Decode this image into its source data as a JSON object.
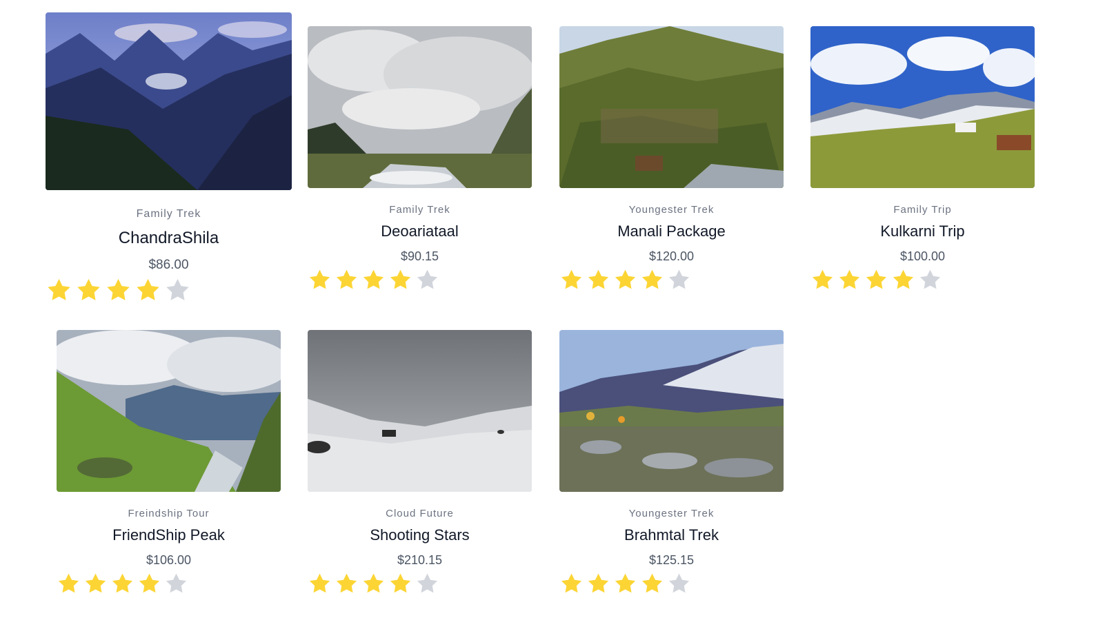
{
  "cards": [
    {
      "category": "Family Trek",
      "title": "ChandraShila",
      "price": "$86.00",
      "rating": 4,
      "max_rating": 5
    },
    {
      "category": "Family Trek",
      "title": "Deoariataal",
      "price": "$90.15",
      "rating": 4,
      "max_rating": 5
    },
    {
      "category": "Youngester Trek",
      "title": "Manali Package",
      "price": "$120.00",
      "rating": 4,
      "max_rating": 5
    },
    {
      "category": "Family Trip",
      "title": "Kulkarni Trip",
      "price": "$100.00",
      "rating": 4,
      "max_rating": 5
    },
    {
      "category": "Freindship Tour",
      "title": "FriendShip Peak",
      "price": "$106.00",
      "rating": 4,
      "max_rating": 5
    },
    {
      "category": "Cloud Future",
      "title": "Shooting Stars",
      "price": "$210.15",
      "rating": 4,
      "max_rating": 5
    },
    {
      "category": "Youngester Trek",
      "title": "Brahmtal Trek",
      "price": "$125.15",
      "rating": 4,
      "max_rating": 5
    }
  ],
  "colors": {
    "star_filled": "#fcd535",
    "star_empty": "#d1d5db",
    "category_text": "#6b7280",
    "price_text": "#4b5563"
  },
  "icons": {
    "star": "star-icon"
  }
}
